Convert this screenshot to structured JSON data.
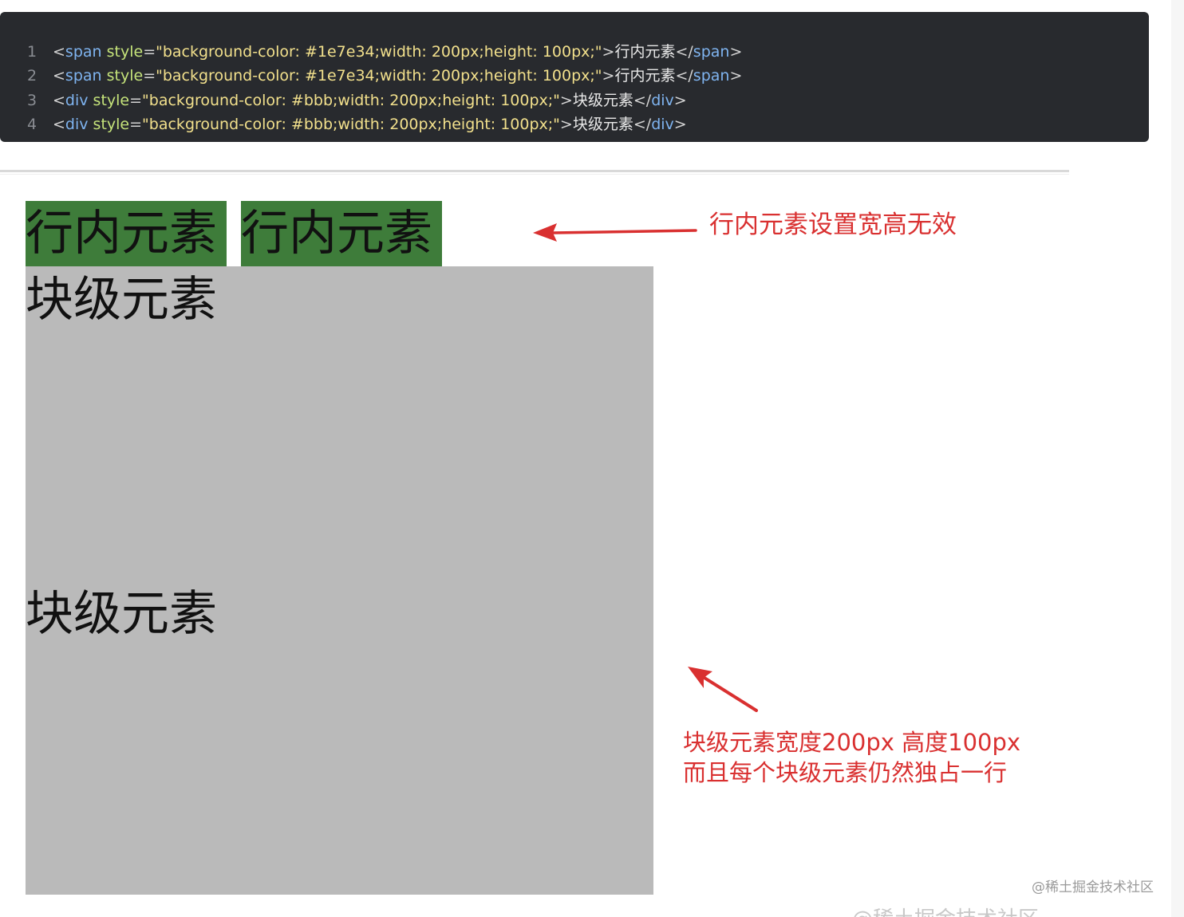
{
  "code": {
    "lines": [
      {
        "num": "1",
        "open": "<",
        "tag": "span",
        "attr": " style",
        "eq": "=",
        "str": "\"background-color: #1e7e34;width: 200px;height: 100px;\"",
        "close": ">",
        "text": "行内元素",
        "end_open": "</",
        "end_tag": "span",
        "end_close": ">"
      },
      {
        "num": "2",
        "open": "<",
        "tag": "span",
        "attr": " style",
        "eq": "=",
        "str": "\"background-color: #1e7e34;width: 200px;height: 100px;\"",
        "close": ">",
        "text": "行内元素",
        "end_open": "</",
        "end_tag": "span",
        "end_close": ">"
      },
      {
        "num": "3",
        "open": "<",
        "tag": "div",
        "attr": " style",
        "eq": "=",
        "str": "\"background-color: #bbb;width: 200px;height: 100px;\"",
        "close": ">",
        "text": "块级元素",
        "end_open": "</",
        "end_tag": "div",
        "end_close": ">"
      },
      {
        "num": "4",
        "open": "<",
        "tag": "div",
        "attr": " style",
        "eq": "=",
        "str": "\"background-color: #bbb;width: 200px;height: 100px;\"",
        "close": ">",
        "text": "块级元素",
        "end_open": "</",
        "end_tag": "div",
        "end_close": ">"
      }
    ]
  },
  "demo": {
    "inline_1": "行内元素",
    "inline_2": "行内元素",
    "block_1": "块级元素",
    "block_2": "块级元素"
  },
  "annotations": {
    "inline_note": "行内元素设置宽高无效",
    "block_note_line1": "块级元素宽度200px 高度100px",
    "block_note_line2": "而且每个块级元素仍然独占一行"
  },
  "watermark": "@稀土掘金技术社区",
  "watermark_faded": "@稀土掘金技术社区",
  "colors": {
    "code_bg": "#282a2e",
    "inline_green": "#3e7c3a",
    "block_gray": "#bababa",
    "annotation_red": "#d93030"
  }
}
